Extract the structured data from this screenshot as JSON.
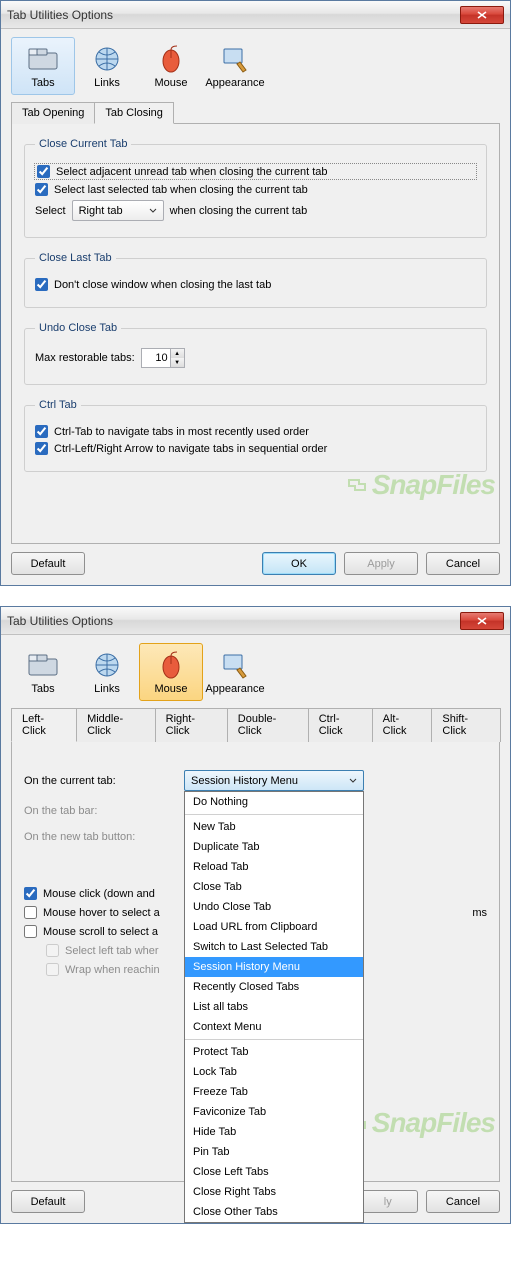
{
  "title": "Tab Utilities Options",
  "iconTabs": [
    "Tabs",
    "Links",
    "Mouse",
    "Appearance"
  ],
  "window1": {
    "activeIconTab": 0,
    "subTabs": [
      "Tab Opening",
      "Tab Closing"
    ],
    "activeSubTab": 1,
    "sections": {
      "closeCurrent": {
        "legend": "Close Current Tab",
        "opt1": "Select adjacent unread tab when closing the current tab",
        "opt2": "Select last selected tab when closing the current tab",
        "selectLabel": "Select",
        "selectValue": "Right tab",
        "selectSuffix": "when closing the current tab"
      },
      "closeLast": {
        "legend": "Close Last Tab",
        "opt1": "Don't close window when closing the last tab"
      },
      "undoClose": {
        "legend": "Undo Close Tab",
        "label": "Max restorable tabs:",
        "value": "10"
      },
      "ctrlTab": {
        "legend": "Ctrl Tab",
        "opt1": "Ctrl-Tab to navigate tabs in most recently used order",
        "opt2": "Ctrl-Left/Right Arrow to navigate tabs in sequential order"
      }
    }
  },
  "window2": {
    "activeIconTab": 2,
    "subTabs": [
      "Left-Click",
      "Middle-Click",
      "Right-Click",
      "Double-Click",
      "Ctrl-Click",
      "Alt-Click",
      "Shift-Click"
    ],
    "activeSubTab": 0,
    "rows": {
      "r1": "On the current tab:",
      "r2": "On the tab bar:",
      "r3": "On the new tab button:"
    },
    "dropdown": {
      "selected": "Session History Menu",
      "items": [
        "Do Nothing",
        "New Tab",
        "Duplicate Tab",
        "Reload Tab",
        "Close Tab",
        "Undo Close Tab",
        "Load URL from Clipboard",
        "Switch to Last Selected Tab",
        "Session History Menu",
        "Recently Closed Tabs",
        "List all tabs",
        "Context Menu",
        "Protect Tab",
        "Lock Tab",
        "Freeze Tab",
        "Faviconize Tab",
        "Hide Tab",
        "Pin Tab",
        "Close Left Tabs",
        "Close Right Tabs",
        "Close Other Tabs"
      ],
      "separatorsAfter": [
        0,
        11
      ]
    },
    "checks": {
      "c1": "Mouse click (down and",
      "c2": "Mouse hover to select a",
      "c3": "Mouse scroll to select a",
      "c4": "Select left tab wher",
      "c5": "Wrap when reachin"
    },
    "c2_suffix": "ms"
  },
  "buttons": {
    "default": "Default",
    "ok": "OK",
    "apply": "Apply",
    "cancel": "Cancel"
  },
  "watermark": "SnapFiles"
}
